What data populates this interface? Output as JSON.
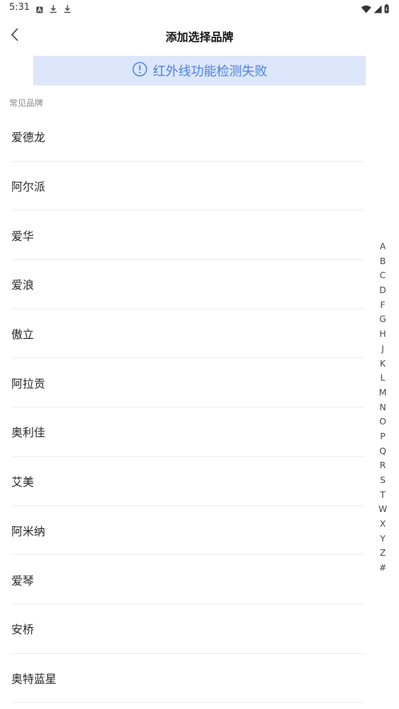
{
  "status_bar": {
    "time": "5:31",
    "left_icons": [
      "a-box-icon",
      "download-icon",
      "download-icon"
    ],
    "right_icons": [
      "wifi-icon",
      "signal-icon",
      "battery-icon"
    ]
  },
  "header": {
    "title": "添加选择品牌",
    "back_icon": "chevron-left-icon"
  },
  "banner": {
    "icon": "info-circle-icon",
    "text": "红外线功能检测失败",
    "color": "#4a7fe0",
    "background": "#dde7fb"
  },
  "section": {
    "label": "常见品牌"
  },
  "brands": [
    "爱德龙",
    "阿尔派",
    "爱华",
    "爱浪",
    "傲立",
    "阿拉贡",
    "奥利佳",
    "艾美",
    "阿米纳",
    "爱琴",
    "安桥",
    "奥特蓝星"
  ],
  "alphabet": [
    "A",
    "B",
    "C",
    "D",
    "F",
    "G",
    "H",
    "J",
    "K",
    "L",
    "M",
    "N",
    "O",
    "P",
    "Q",
    "R",
    "S",
    "T",
    "W",
    "X",
    "Y",
    "Z",
    "#"
  ]
}
